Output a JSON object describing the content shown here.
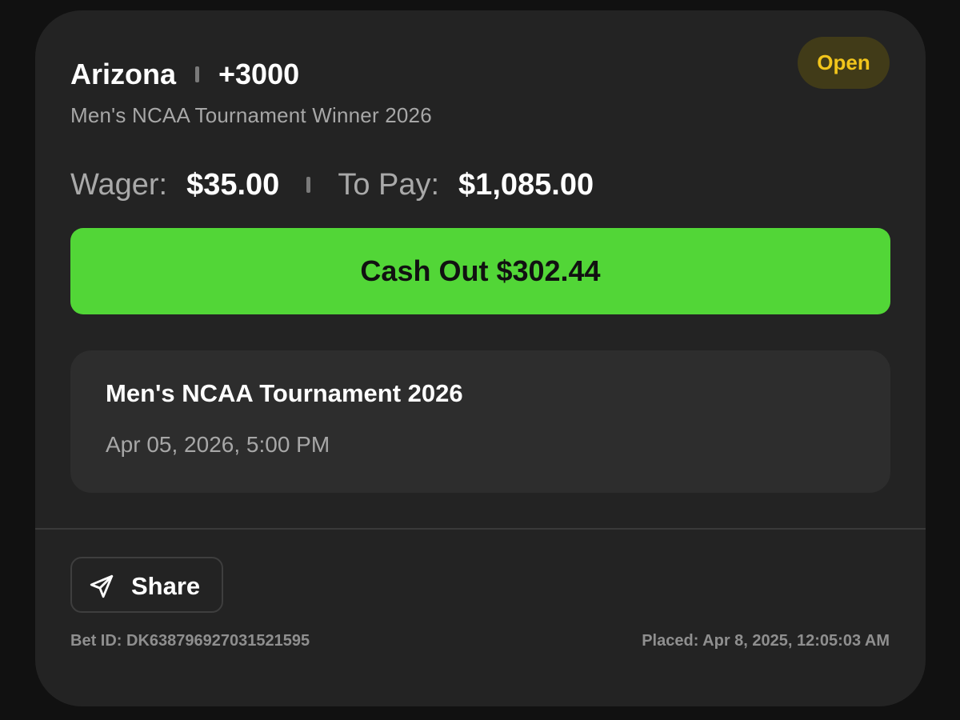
{
  "bet": {
    "team": "Arizona",
    "odds": "+3000",
    "market": "Men's NCAA Tournament Winner 2026",
    "status": "Open",
    "wager_label": "Wager:",
    "wager_value": "$35.00",
    "to_pay_label": "To Pay:",
    "to_pay_value": "$1,085.00",
    "cash_out_label": "Cash Out $302.44"
  },
  "event": {
    "name": "Men's NCAA Tournament 2026",
    "date": "Apr 05, 2026, 5:00 PM"
  },
  "footer": {
    "share_label": "Share",
    "share_icon": "send-icon",
    "bet_id": "Bet ID: DK638796927031521595",
    "placed": "Placed: Apr 8, 2025, 12:05:03 AM"
  },
  "colors": {
    "background": "#111111",
    "card": "#232323",
    "cash_out_button": "#52d637",
    "status_badge_bg": "#413b18",
    "status_badge_text": "#f2c51b"
  }
}
